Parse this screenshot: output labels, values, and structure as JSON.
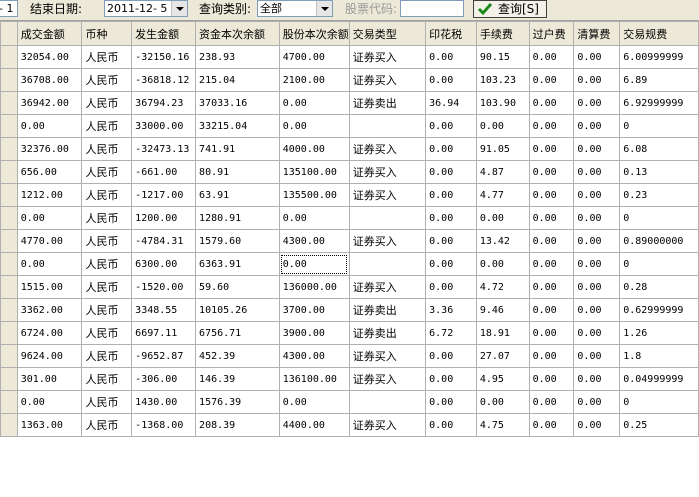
{
  "toolbar": {
    "start_date_tail": "- 1",
    "end_date_label": "结束日期:",
    "end_date_value": "2011-12- 5",
    "query_type_label": "查询类别:",
    "query_type_value": "全部",
    "stock_code_label": "股票代码:",
    "stock_code_value": "",
    "query_button": "查询[S]"
  },
  "columns": [
    "成交金额",
    "币种",
    "发生金额",
    "资金本次余额",
    "股份本次余额",
    "交易类型",
    "印花税",
    "手续费",
    "过户费",
    "清算费",
    "交易规费"
  ],
  "rows": [
    [
      "32054.00",
      "人民币",
      "-32150.16",
      "238.93",
      "4700.00",
      "证券买入",
      "0.00",
      "90.15",
      "0.00",
      "0.00",
      "6.00999999"
    ],
    [
      "36708.00",
      "人民币",
      "-36818.12",
      "215.04",
      "2100.00",
      "证券买入",
      "0.00",
      "103.23",
      "0.00",
      "0.00",
      "6.89"
    ],
    [
      "36942.00",
      "人民币",
      "36794.23",
      "37033.16",
      "0.00",
      "证券卖出",
      "36.94",
      "103.90",
      "0.00",
      "0.00",
      "6.92999999"
    ],
    [
      "0.00",
      "人民币",
      "33000.00",
      "33215.04",
      "0.00",
      "",
      "0.00",
      "0.00",
      "0.00",
      "0.00",
      "0"
    ],
    [
      "32376.00",
      "人民币",
      "-32473.13",
      "741.91",
      "4000.00",
      "证券买入",
      "0.00",
      "91.05",
      "0.00",
      "0.00",
      "6.08"
    ],
    [
      "656.00",
      "人民币",
      "-661.00",
      "80.91",
      "135100.00",
      "证券买入",
      "0.00",
      "4.87",
      "0.00",
      "0.00",
      "0.13"
    ],
    [
      "1212.00",
      "人民币",
      "-1217.00",
      "63.91",
      "135500.00",
      "证券买入",
      "0.00",
      "4.77",
      "0.00",
      "0.00",
      "0.23"
    ],
    [
      "0.00",
      "人民币",
      "1200.00",
      "1280.91",
      "0.00",
      "",
      "0.00",
      "0.00",
      "0.00",
      "0.00",
      "0"
    ],
    [
      "4770.00",
      "人民币",
      "-4784.31",
      "1579.60",
      "4300.00",
      "证券买入",
      "0.00",
      "13.42",
      "0.00",
      "0.00",
      "0.89000000"
    ],
    [
      "0.00",
      "人民币",
      "6300.00",
      "6363.91",
      "0.00",
      "",
      "0.00",
      "0.00",
      "0.00",
      "0.00",
      "0"
    ],
    [
      "1515.00",
      "人民币",
      "-1520.00",
      "59.60",
      "136000.00",
      "证券买入",
      "0.00",
      "4.72",
      "0.00",
      "0.00",
      "0.28"
    ],
    [
      "3362.00",
      "人民币",
      "3348.55",
      "10105.26",
      "3700.00",
      "证券卖出",
      "3.36",
      "9.46",
      "0.00",
      "0.00",
      "0.62999999"
    ],
    [
      "6724.00",
      "人民币",
      "6697.11",
      "6756.71",
      "3900.00",
      "证券卖出",
      "6.72",
      "18.91",
      "0.00",
      "0.00",
      "1.26"
    ],
    [
      "9624.00",
      "人民币",
      "-9652.87",
      "452.39",
      "4300.00",
      "证券买入",
      "0.00",
      "27.07",
      "0.00",
      "0.00",
      "1.8"
    ],
    [
      "301.00",
      "人民币",
      "-306.00",
      "146.39",
      "136100.00",
      "证券买入",
      "0.00",
      "4.95",
      "0.00",
      "0.00",
      "0.04999999"
    ],
    [
      "0.00",
      "人民币",
      "1430.00",
      "1576.39",
      "0.00",
      "",
      "0.00",
      "0.00",
      "0.00",
      "0.00",
      "0"
    ],
    [
      "1363.00",
      "人民币",
      "-1368.00",
      "208.39",
      "4400.00",
      "证券买入",
      "0.00",
      "4.75",
      "0.00",
      "0.00",
      "0.25"
    ]
  ]
}
